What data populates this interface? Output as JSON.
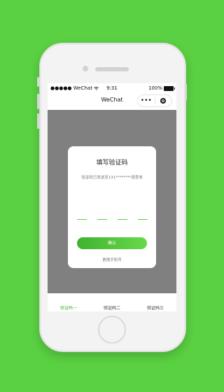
{
  "colors": {
    "background": "#5ad142",
    "accent_green": "#3fb22f",
    "overlay_gray": "#808080"
  },
  "status_bar": {
    "carrier": "●●●●● WeChat",
    "wifi_icon": "wifi-icon",
    "time": "9:31",
    "battery_text": "100%",
    "battery_icon": "battery-icon"
  },
  "nav": {
    "title": "WeChat",
    "menu_icon": "more-dots-icon",
    "close_icon": "target-circle-icon",
    "menu_text": "•••"
  },
  "dialog": {
    "title": "填写验证码",
    "subtitle": "验证码已发送至131********请查收",
    "code_digits": 4,
    "confirm_label": "确认",
    "change_phone_label": "更换手机号"
  },
  "tabs": [
    {
      "label": "验证码一",
      "active": true
    },
    {
      "label": "验证码二",
      "active": false
    },
    {
      "label": "验证码三",
      "active": false
    }
  ]
}
